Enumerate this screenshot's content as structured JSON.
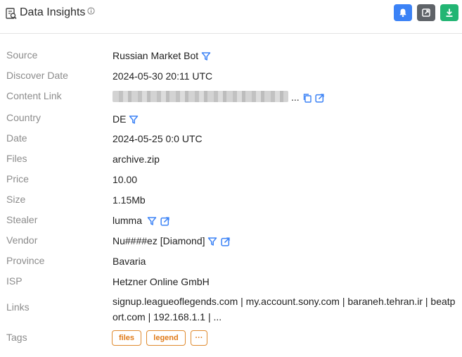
{
  "header": {
    "title": "Data Insights",
    "icon": "report-search-icon",
    "info_icon": "info-circle-icon",
    "buttons": [
      {
        "name": "notify-button",
        "icon": "bell-icon",
        "color": "#3b82f6"
      },
      {
        "name": "open-external-button",
        "icon": "external-link-icon",
        "color": "#5f6368"
      },
      {
        "name": "download-button",
        "icon": "download-icon",
        "color": "#22b573"
      }
    ]
  },
  "fields": {
    "source": {
      "label": "Source",
      "value": "Russian Market Bot"
    },
    "discover_date": {
      "label": "Discover Date",
      "value": "2024-05-30 20:11 UTC"
    },
    "content_link": {
      "label": "Content Link",
      "value": "..."
    },
    "country": {
      "label": "Country",
      "value": "DE"
    },
    "date": {
      "label": "Date",
      "value": "2024-05-25 0:0 UTC"
    },
    "files": {
      "label": "Files",
      "value": "archive.zip"
    },
    "price": {
      "label": "Price",
      "value": "10.00"
    },
    "size": {
      "label": "Size",
      "value": "1.15Mb"
    },
    "stealer": {
      "label": "Stealer",
      "value": "lumma"
    },
    "vendor": {
      "label": "Vendor",
      "value": "Nu####ez [Diamond]"
    },
    "province": {
      "label": "Province",
      "value": "Bavaria"
    },
    "isp": {
      "label": "ISP",
      "value": "Hetzner Online GmbH"
    },
    "links": {
      "label": "Links",
      "value": "signup.leagueoflegends.com | my.account.sony.com | baraneh.tehran.ir | beatport.com | 192.168.1.1 | ..."
    },
    "tags": {
      "label": "Tags",
      "items": [
        "files",
        "legend",
        "···"
      ]
    }
  },
  "colors": {
    "accent": "#3b82f6",
    "tag": "#e07b1a",
    "label": "#8c8c8c"
  }
}
